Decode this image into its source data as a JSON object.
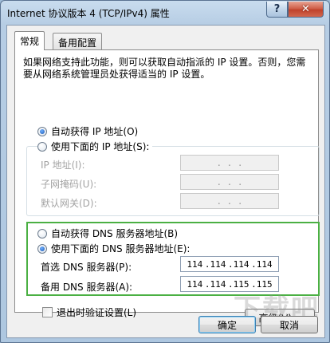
{
  "window": {
    "title": "Internet 协议版本 4 (TCP/IPv4) 属性",
    "help_glyph": "?",
    "close_glyph": "✕"
  },
  "tabs": [
    {
      "label": "常规"
    },
    {
      "label": "备用配置"
    }
  ],
  "description": "如果网络支持此功能，则可以获取自动指派的 IP 设置。否则，您需要从网络系统管理员处获得适当的 IP 设置。",
  "ip_section": {
    "auto_label": "自动获得 IP 地址(O)",
    "manual_label": "使用下面的 IP 地址(S):",
    "auto_selected": true,
    "fields": [
      {
        "label": "IP 地址(I):",
        "value": ".   .   ."
      },
      {
        "label": "子网掩码(U):",
        "value": ".   .   ."
      },
      {
        "label": "默认网关(D):",
        "value": ".   .   ."
      }
    ]
  },
  "dns_section": {
    "auto_label": "自动获得 DNS 服务器地址(B)",
    "manual_label": "使用下面的 DNS 服务器地址(E):",
    "manual_selected": true,
    "preferred": {
      "label": "首选 DNS 服务器(P):",
      "octets": [
        "114",
        ".114",
        ".114",
        ".114"
      ]
    },
    "alternate": {
      "label": "备用 DNS 服务器(A):",
      "octets": [
        "114",
        ".114",
        ".115",
        ".115"
      ]
    }
  },
  "validate_label": "退出时验证设置(L)",
  "advanced_button": "高级(V)...",
  "ok_button": "确定",
  "cancel_button": "取消",
  "watermark": "下载吧",
  "colors": {
    "highlight_frame": "#4bb043",
    "close_button": "#c0422b"
  }
}
